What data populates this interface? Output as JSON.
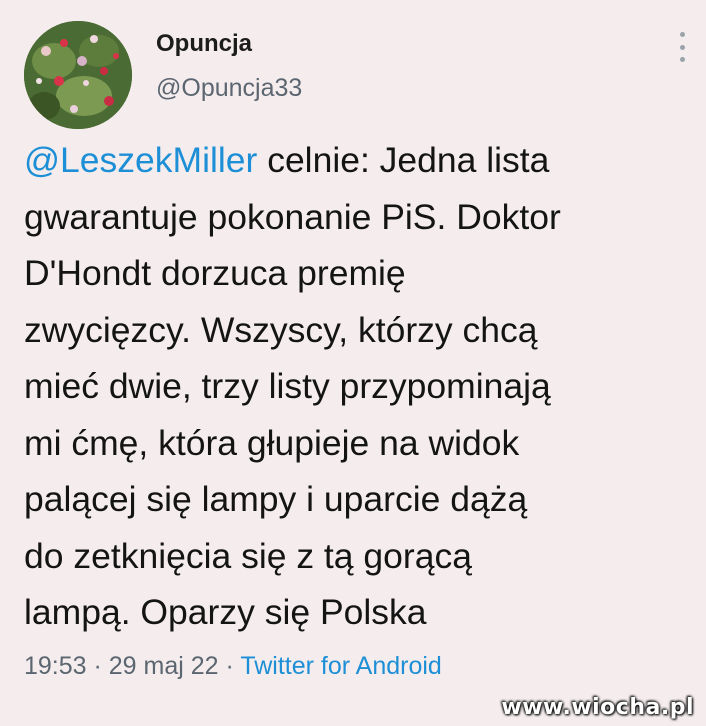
{
  "author": {
    "display_name": "Opuncja",
    "handle": "@Opuncja33",
    "avatar": "cactus-flower-photo"
  },
  "tweet": {
    "mention": "@LeszekMiller",
    "first_line_rest": " celnie: Jedna lista",
    "lines": [
      "gwarantuje pokonanie PiS. Doktor",
      "D'Hondt dorzuca premię",
      "zwycięzcy. Wszyscy, którzy chcą",
      "mieć dwie, trzy listy przypominają",
      "mi ćmę, która głupieje na widok",
      "palącej się lampy i uparcie dążą",
      "do zetknięcia się z tą gorącą",
      "lampą. Oparzy się Polska"
    ]
  },
  "meta": {
    "time": "19:53",
    "sep1": " · ",
    "date": "29 maj 22",
    "sep2": " · ",
    "source": "Twitter for Android"
  },
  "watermark": "www.wiocha.pl",
  "icons": {
    "more": "more-vertical-icon"
  },
  "colors": {
    "background": "#f5eded",
    "link": "#1d8fd6",
    "secondary_text": "#5b6670"
  }
}
